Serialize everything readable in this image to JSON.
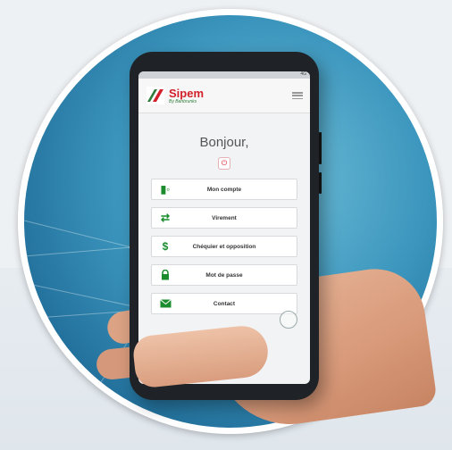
{
  "app": {
    "brand_name": "Sipem",
    "brand_sub": "By Banbrunks",
    "status_text": "4G"
  },
  "greeting": "Bonjour,",
  "menu": [
    {
      "label": "Mon compte",
      "icon": "wallet-icon"
    },
    {
      "label": "Virement",
      "icon": "transfer-icon"
    },
    {
      "label": "Chéquier et opposition",
      "icon": "dollar-icon"
    },
    {
      "label": "Mot de passe",
      "icon": "lock-icon"
    },
    {
      "label": "Contact",
      "icon": "envelope-icon"
    }
  ],
  "colors": {
    "brand_red": "#d21f2a",
    "brand_green": "#1a8c2e",
    "background_blue": "#3b95bd"
  }
}
